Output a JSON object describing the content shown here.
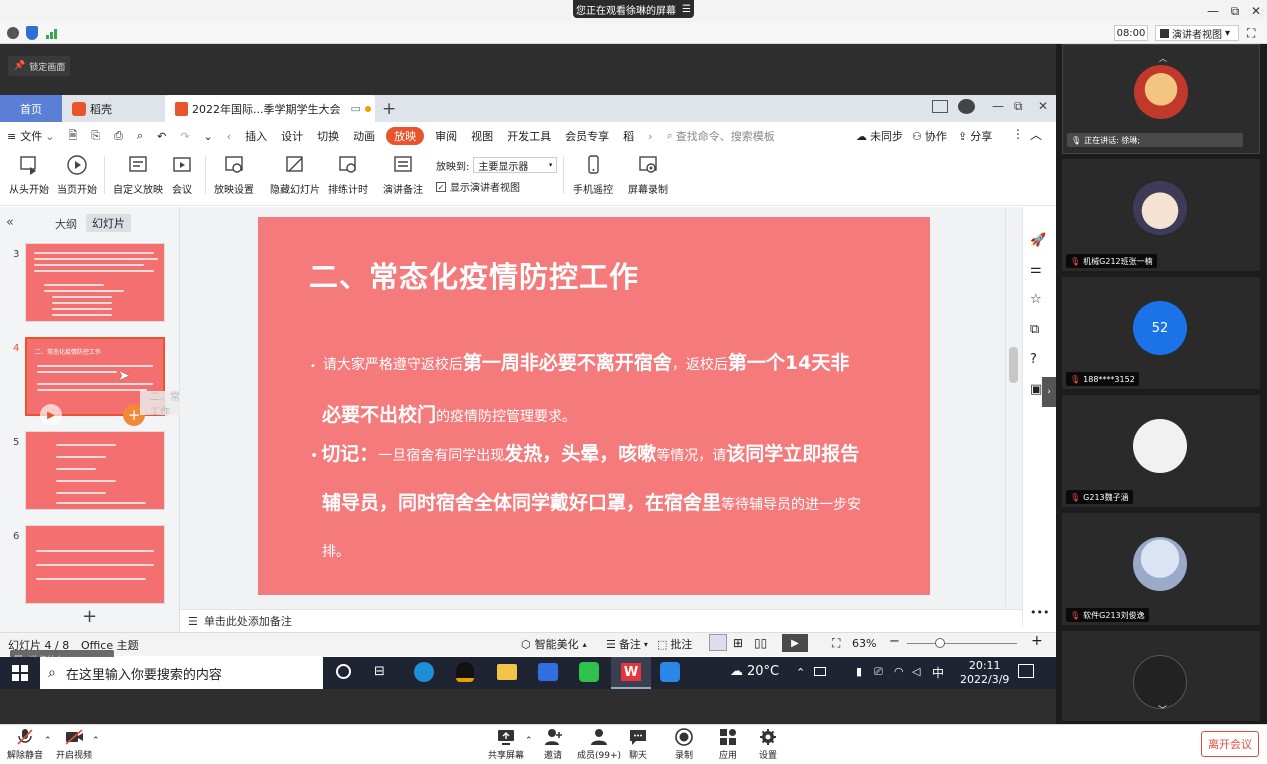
{
  "topbar": {
    "sharing_banner": "您正在观看徐琳的屏幕",
    "banner_menu": "☰"
  },
  "meeting_top": {
    "time": "08:00",
    "presenter_view": "演讲者视图",
    "presenter_arrow": "▾"
  },
  "lock_screen": "锁定画面",
  "wps": {
    "tabs": {
      "home": "首页",
      "docer": "稻壳",
      "doc": "2022年国际...季学期学生大会",
      "add": "+"
    },
    "menu": {
      "file": "文件",
      "items": [
        "插入",
        "设计",
        "切换",
        "动画",
        "放映",
        "审阅",
        "视图",
        "开发工具",
        "会员专享",
        "稻"
      ],
      "search": "查找命令、搜索模板",
      "unsync": "未同步",
      "collab": "协作",
      "share": "分享"
    },
    "ribbon": {
      "from_start": "从头开始",
      "from_current": "当页开始",
      "custom": "自定义放映",
      "meeting": "会议",
      "settings": "放映设置",
      "hide": "隐藏幻灯片",
      "rehearse": "排练计时",
      "notes": "演讲备注",
      "show_to_label": "放映到:",
      "show_to_value": "主要显示器",
      "presenter_view_check": "显示演讲者视图",
      "remote": "手机遥控",
      "record": "屏幕录制"
    },
    "panel_tabs": {
      "outline": "大纲",
      "slides": "幻灯片"
    },
    "thumb_numbers": [
      "3",
      "4",
      "5",
      "6"
    ],
    "thumb4_title": "二、常态化疫情防控工作",
    "drag_ghost": "二、常态化疫情防控工作",
    "add_slide": "+",
    "slide": {
      "title": "二、常态化疫情防控工作",
      "b1_a": "请大家严格遵守返校后",
      "b1_b": "第一周非必要不离开宿舍",
      "b1_c": "，返校后",
      "b1_d": "第一个14天非",
      "b1_e": "必要不出校门",
      "b1_f": "的疫情防控管理要求。",
      "b2_a": "切记：",
      "b2_b": "一旦宿舍有同学出现",
      "b2_c": "发热，头晕，咳嗽",
      "b2_d": "等情况，",
      "b2_e": "请",
      "b2_f": "该同学立即报告",
      "b2_g": "辅导员，同时宿舍全体同学戴好口罩，在宿舍里",
      "b2_h": "等待辅导员的进一步安",
      "b2_i": "排。"
    },
    "notes_placeholder": "单击此处添加备注",
    "status": {
      "slide_count": "幻灯片 4 / 8",
      "theme": "Office 主题",
      "beautify": "智能美化",
      "notes": "备注",
      "comment": "批注",
      "zoom": "63%"
    }
  },
  "taskbar": {
    "search": "在这里输入你要搜索的内容",
    "weather": "20°C",
    "ime": "中",
    "time": "20:11",
    "date": "2022/3/9",
    "speech_bubble": "说点什么..."
  },
  "meeting_bottom": {
    "mute": "解除静音",
    "video": "开启视频",
    "share": "共享屏幕",
    "invite": "邀请",
    "members": "成员(99+)",
    "chat": "聊天",
    "record": "录制",
    "apps": "应用",
    "settings": "设置",
    "leave": "离开会议"
  },
  "participants": {
    "speaking": "正在讲话: 徐琳;",
    "p1": "机械G212班张一楠",
    "p2": "188****3152",
    "p2_avatar": "52",
    "p3": "G213魏子涵",
    "p4": "软件G213刘俊逸"
  },
  "colors": {
    "slide_bg": "#f57a7b",
    "accent_blue": "#5b7fd6",
    "wps_red": "#e8542e",
    "leave_red": "#e74c3c",
    "avatar_blue": "#1a73e8"
  }
}
